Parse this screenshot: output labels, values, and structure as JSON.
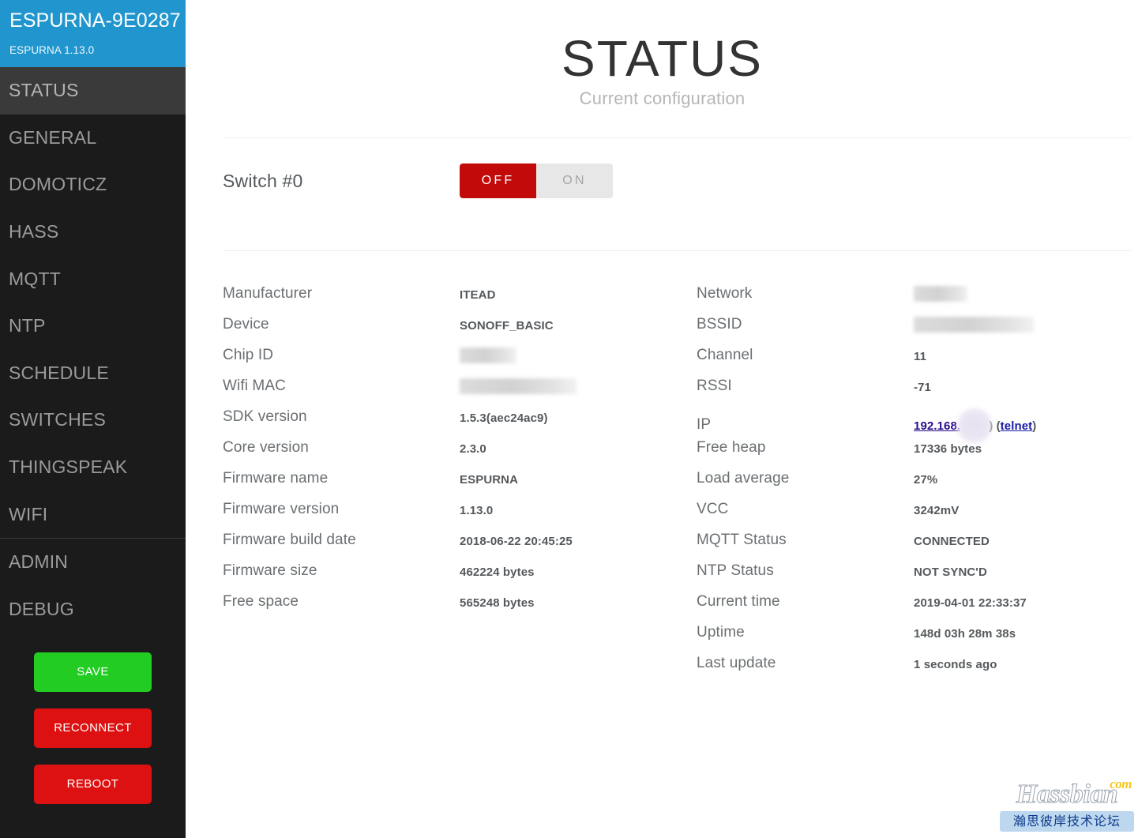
{
  "sidebar": {
    "device_name": "ESPURNA-9E0287",
    "firmware_label": "ESPURNA 1.13.0",
    "nav_items": [
      {
        "label": "STATUS",
        "active": true
      },
      {
        "label": "GENERAL",
        "active": false
      },
      {
        "label": "DOMOTICZ",
        "active": false
      },
      {
        "label": "HASS",
        "active": false
      },
      {
        "label": "MQTT",
        "active": false
      },
      {
        "label": "NTP",
        "active": false
      },
      {
        "label": "SCHEDULE",
        "active": false
      },
      {
        "label": "SWITCHES",
        "active": false
      },
      {
        "label": "THINGSPEAK",
        "active": false
      },
      {
        "label": "WIFI",
        "active": false
      }
    ],
    "nav_items_secondary": [
      {
        "label": "ADMIN",
        "active": false
      },
      {
        "label": "DEBUG",
        "active": false
      }
    ],
    "buttons": [
      {
        "label": "SAVE",
        "color": "#22cc22"
      },
      {
        "label": "RECONNECT",
        "color": "#dd1111"
      },
      {
        "label": "REBOOT",
        "color": "#dd1111"
      }
    ],
    "header_color": "#2196ce",
    "background_color": "#1b1b1b",
    "active_item_color": "#3a3a3a"
  },
  "main": {
    "title": "STATUS",
    "subtitle": "Current configuration",
    "switch": {
      "label": "Switch #0",
      "off_label": "OFF",
      "on_label": "ON",
      "state": "OFF",
      "off_color": "#c20a0a",
      "on_color": "#e7e7e7"
    },
    "left_column": [
      {
        "key": "Manufacturer",
        "value": "ITEAD"
      },
      {
        "key": "Device",
        "value": "SONOFF_BASIC"
      },
      {
        "key": "Chip ID",
        "value": "",
        "redacted": "short"
      },
      {
        "key": "Wifi MAC",
        "value": "",
        "redacted": "long"
      },
      {
        "key": "SDK version",
        "value": "1.5.3(aec24ac9)"
      },
      {
        "key": "Core version",
        "value": "2.3.0"
      },
      {
        "key": "Firmware name",
        "value": "ESPURNA"
      },
      {
        "key": "Firmware version",
        "value": "1.13.0"
      },
      {
        "key": "Firmware build date",
        "value": "2018-06-22 20:45:25"
      },
      {
        "key": "Firmware size",
        "value": "462224 bytes"
      },
      {
        "key": "Free space",
        "value": "565248 bytes"
      }
    ],
    "right_column": [
      {
        "key": "Network",
        "value": "",
        "redacted": "net"
      },
      {
        "key": "BSSID",
        "value": "",
        "redacted": "bssid"
      },
      {
        "key": "Channel",
        "value": "11"
      },
      {
        "key": "RSSI",
        "value": "-71"
      },
      {
        "key": "IP",
        "value": "192.168.",
        "link": true,
        "telnet_label": "telnet"
      },
      {
        "key": "Free heap",
        "value": "17336 bytes"
      },
      {
        "key": "Load average",
        "value": "27%"
      },
      {
        "key": "VCC",
        "value": "3242mV"
      },
      {
        "key": "MQTT Status",
        "value": "CONNECTED"
      },
      {
        "key": "NTP Status",
        "value": "NOT SYNC'D"
      },
      {
        "key": "Current time",
        "value": "2019-04-01 22:33:37"
      },
      {
        "key": "Uptime",
        "value": "148d 03h 28m 38s"
      },
      {
        "key": "Last update",
        "value": "1 seconds ago"
      }
    ]
  },
  "watermark": {
    "word": "Hassbian",
    "tld": "com",
    "chinese": "瀚思彼岸技术论坛"
  }
}
